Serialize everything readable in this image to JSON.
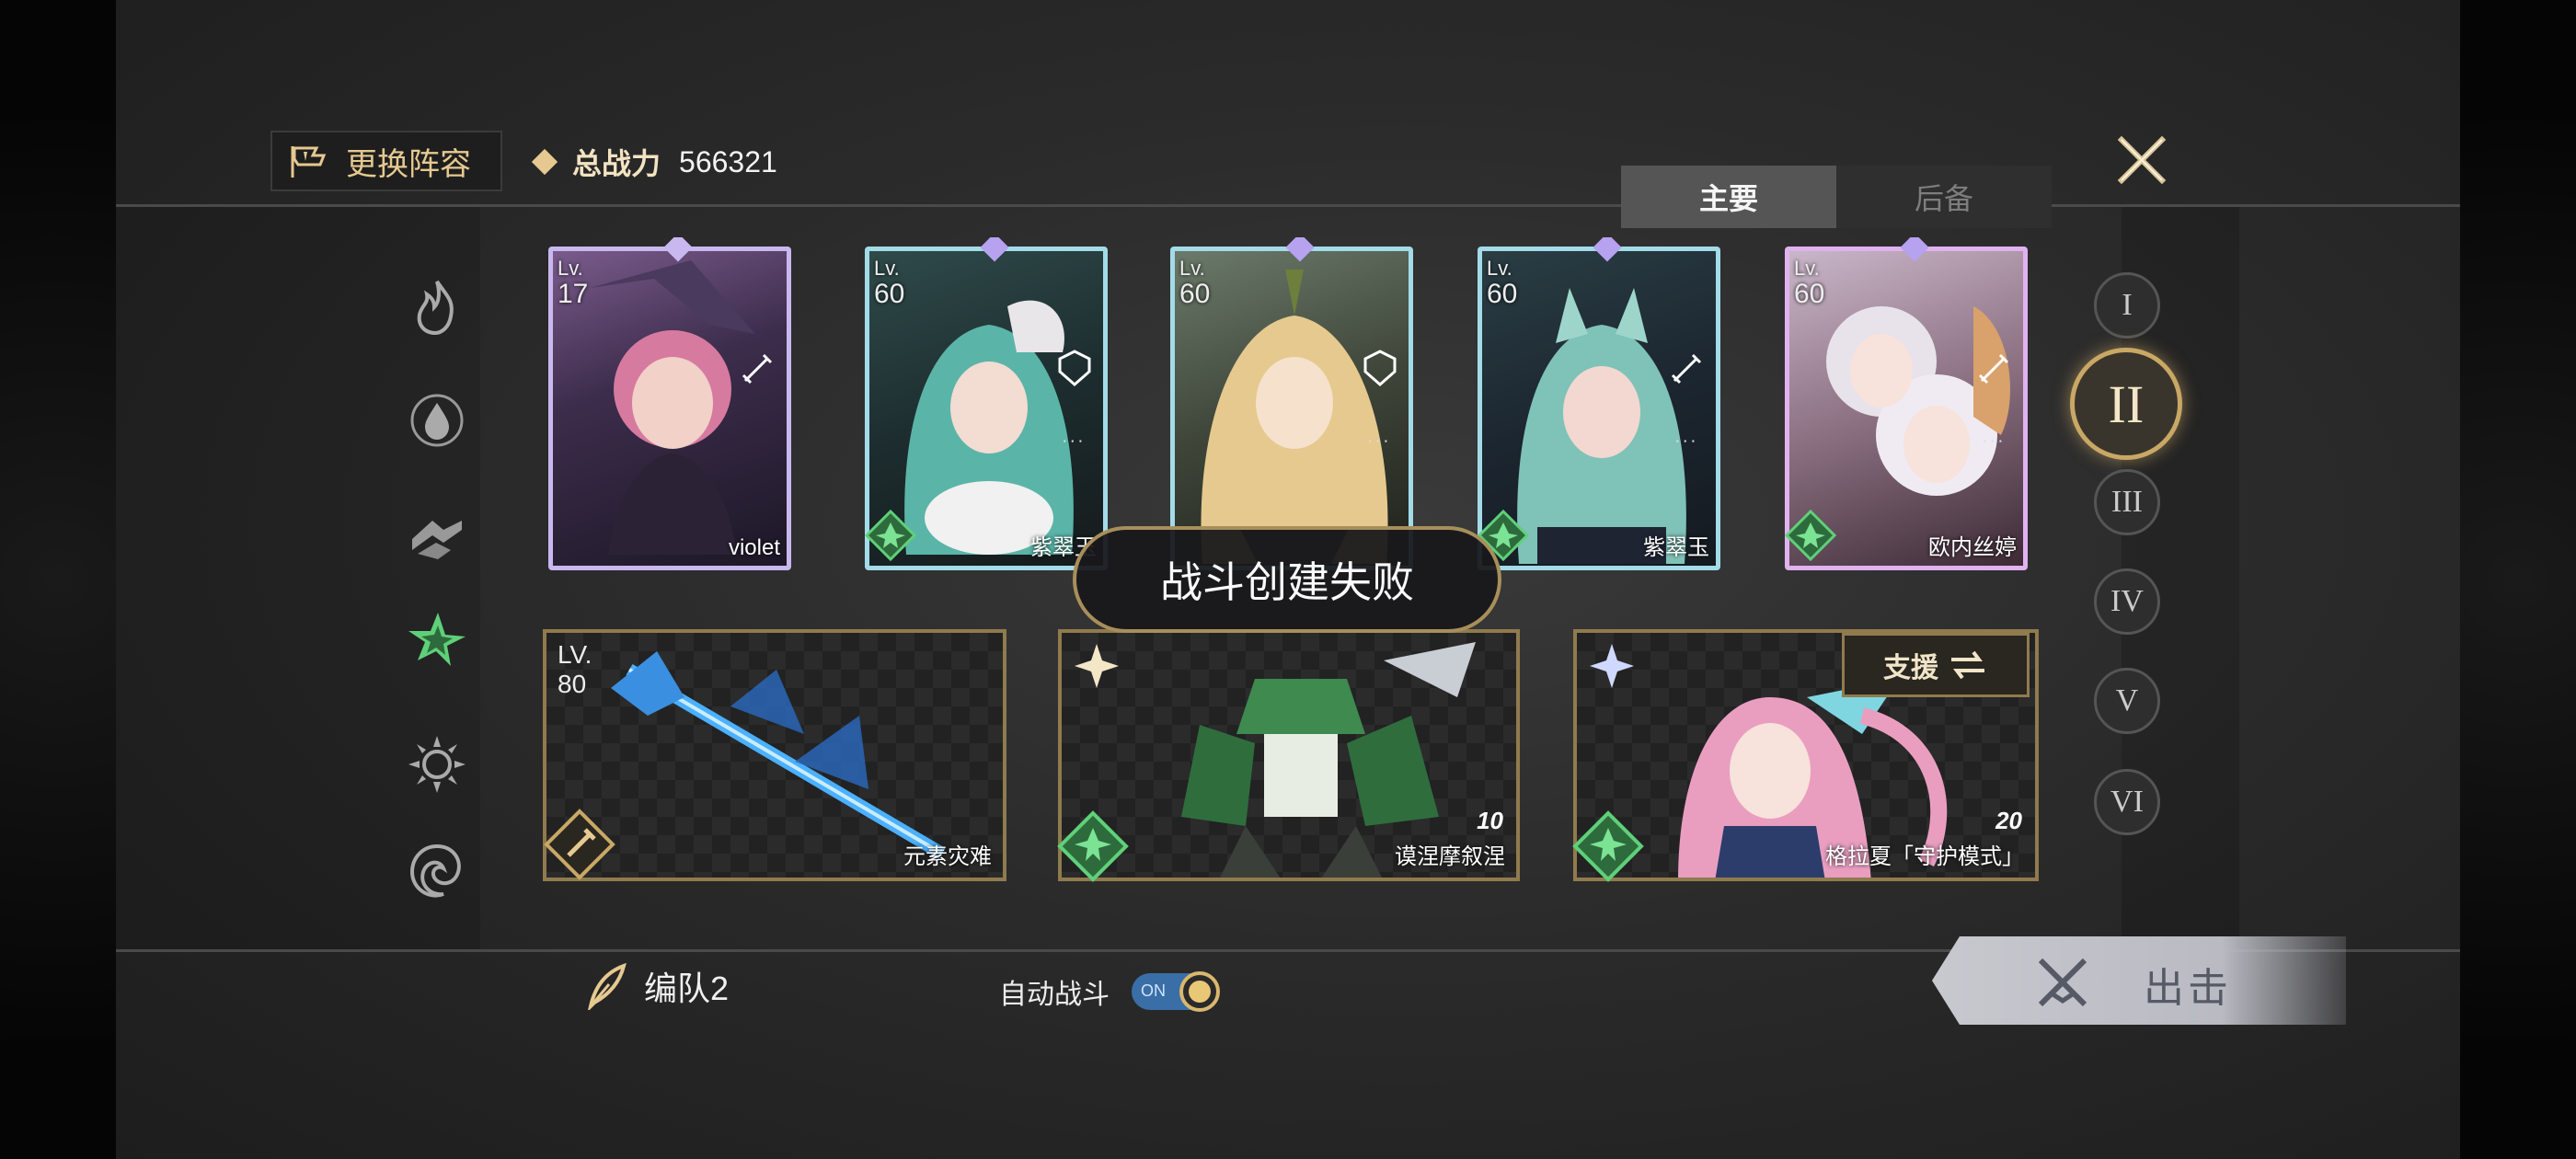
{
  "header": {
    "change_team_label": "更换阵容",
    "power_label": "总战力",
    "power_value": "566321",
    "tabs": [
      {
        "label": "主要",
        "active": true
      },
      {
        "label": "后备",
        "active": false
      }
    ]
  },
  "elements": [
    {
      "icon": "fire-icon"
    },
    {
      "icon": "water-icon"
    },
    {
      "icon": "earth-icon"
    },
    {
      "icon": "wind-icon",
      "active": true
    },
    {
      "icon": "light-icon"
    },
    {
      "icon": "dark-icon"
    }
  ],
  "characters": [
    {
      "lv_label": "Lv.",
      "level": "17",
      "name": "violet",
      "frame": "#b8a6e6"
    },
    {
      "lv_label": "Lv.",
      "level": "60",
      "name": "紫翠玉",
      "frame": "#9ad9e8"
    },
    {
      "lv_label": "Lv.",
      "level": "60",
      "name": "",
      "frame": "#9ad9e8"
    },
    {
      "lv_label": "Lv.",
      "level": "60",
      "name": "紫翠玉",
      "frame": "#9ad9e8"
    },
    {
      "lv_label": "Lv.",
      "level": "60",
      "name": "欧内丝婷",
      "frame": "#d7a6e6"
    }
  ],
  "slots": {
    "weapon": {
      "lv_label": "LV.",
      "level": "80",
      "name": "元素灾难"
    },
    "mech": {
      "name": "谟涅摩叙涅",
      "count": "10"
    },
    "support": {
      "label": "支援",
      "name": "格拉夏「守护模式」",
      "count": "20"
    }
  },
  "toast": "战斗创建失败",
  "team_numerals": [
    "I",
    "II",
    "III",
    "IV",
    "V",
    "VI"
  ],
  "active_team_index": 1,
  "footer": {
    "team_name": "编队2",
    "auto_battle_label": "自动战斗",
    "toggle_state": "ON",
    "attack_label": "出击"
  },
  "colors": {
    "gold": "#c9a865",
    "active_element": "#5fd07a",
    "toggle_blue": "#3a6ea6"
  }
}
